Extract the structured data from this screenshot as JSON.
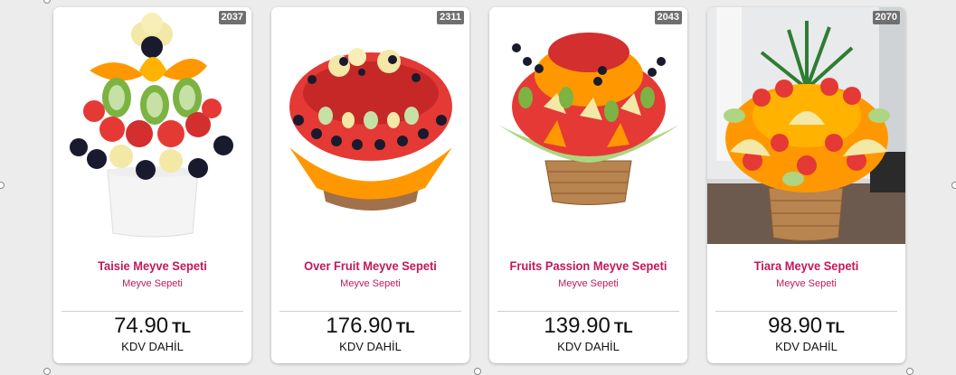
{
  "products": [
    {
      "code": "2037",
      "name": "Taisie Meyve Sepeti",
      "category": "Meyve Sepeti",
      "price": "74.90",
      "currency": "TL",
      "vat": "KDV DAHİL",
      "image": "fruit-bouquet-white-vase"
    },
    {
      "code": "2311",
      "name": "Over Fruit Meyve Sepeti",
      "category": "Meyve Sepeti",
      "price": "176.90",
      "currency": "TL",
      "vat": "KDV DAHİL",
      "image": "fruit-bouquet-low-basket"
    },
    {
      "code": "2043",
      "name": "Fruits Passion Meyve Sepeti",
      "category": "Meyve Sepeti",
      "price": "139.90",
      "currency": "TL",
      "vat": "KDV DAHİL",
      "image": "fruit-bouquet-wicker-basket"
    },
    {
      "code": "2070",
      "name": "Tiara Meyve Sepeti",
      "category": "Meyve Sepeti",
      "price": "98.90",
      "currency": "TL",
      "vat": "KDV DAHİL",
      "image": "fruit-bouquet-pineapple-basket"
    }
  ]
}
